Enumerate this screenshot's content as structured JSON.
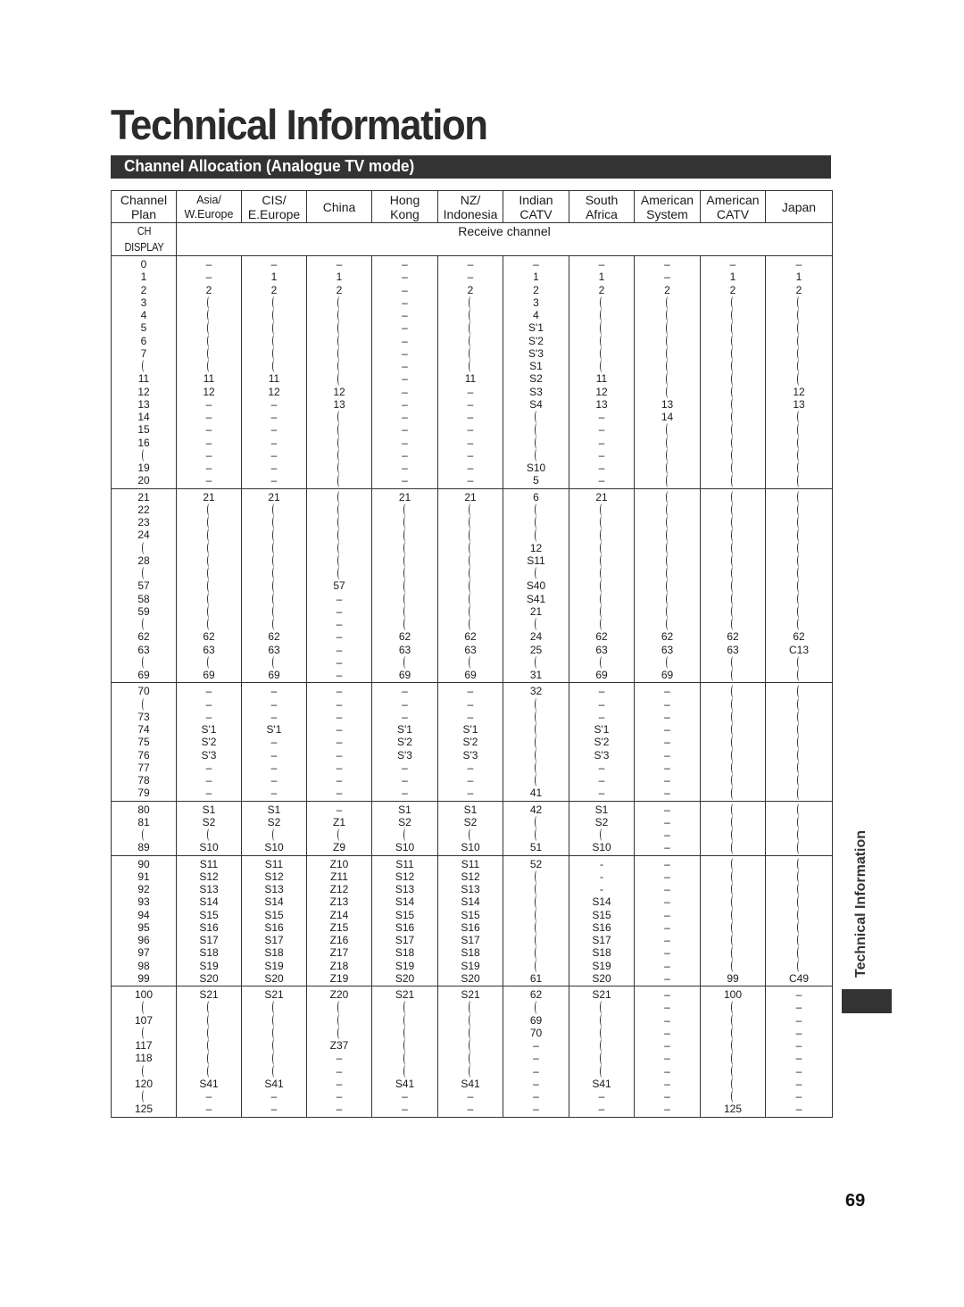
{
  "page": {
    "title": "Technical Information",
    "section_title": "Channel Allocation (Analogue TV mode)",
    "side_tab_label": "Technical Information",
    "page_number": "69"
  },
  "table": {
    "headers": [
      {
        "line1": "Channel",
        "line2": "Plan"
      },
      {
        "line1": "Asia/",
        "line2": "W.Europe"
      },
      {
        "line1": "CIS/",
        "line2": "E.Europe"
      },
      {
        "line1": "China",
        "line2": ""
      },
      {
        "line1": "Hong",
        "line2": "Kong"
      },
      {
        "line1": "NZ/",
        "line2": "Indonesia"
      },
      {
        "line1": "Indian",
        "line2": "CATV"
      },
      {
        "line1": "South",
        "line2": "Africa"
      },
      {
        "line1": "American",
        "line2": "System"
      },
      {
        "line1": "American",
        "line2": "CATV"
      },
      {
        "line1": "Japan",
        "line2": ""
      }
    ],
    "ch_display_label": "CH DISPLAY",
    "receive_channel_label": "Receive channel",
    "wave_marker": "~",
    "groups": [
      [
        [
          "0",
          "–",
          "–",
          "–",
          "–",
          "–",
          "–",
          "–",
          "–",
          "–",
          "–"
        ],
        [
          "1",
          "–",
          "1",
          "1",
          "–",
          "–",
          "1",
          "1",
          "–",
          "1",
          "1"
        ],
        [
          "2",
          "2",
          "2",
          "2",
          "–",
          "2",
          "2",
          "2",
          "2",
          "2",
          "2"
        ],
        [
          "3",
          "~",
          "~",
          "~",
          "–",
          "~",
          "3",
          "~",
          "~",
          "~",
          "~"
        ],
        [
          "4",
          "~",
          "~",
          "~",
          "–",
          "~",
          "4",
          "~",
          "~",
          "~",
          "~"
        ],
        [
          "5",
          "~",
          "~",
          "~",
          "–",
          "~",
          "S'1",
          "~",
          "~",
          "~",
          "~"
        ],
        [
          "6",
          "~",
          "~",
          "~",
          "–",
          "~",
          "S'2",
          "~",
          "~",
          "~",
          "~"
        ],
        [
          "7",
          "~",
          "~",
          "~",
          "–",
          "~",
          "S'3",
          "~",
          "~",
          "~",
          "~"
        ],
        [
          "~",
          "~",
          "~",
          "~",
          "–",
          "~",
          "S1",
          "~",
          "~",
          "~",
          "~"
        ],
        [
          "11",
          "11",
          "11",
          "~",
          "–",
          "11",
          "S2",
          "11",
          "~",
          "~",
          "~"
        ],
        [
          "12",
          "12",
          "12",
          "12",
          "–",
          "–",
          "S3",
          "12",
          "~",
          "~",
          "12"
        ],
        [
          "13",
          "–",
          "–",
          "13",
          "–",
          "–",
          "S4",
          "13",
          "13",
          "~",
          "13"
        ],
        [
          "14",
          "–",
          "–",
          "~",
          "–",
          "–",
          "~",
          "–",
          "14",
          "~",
          "~"
        ],
        [
          "15",
          "–",
          "–",
          "~",
          "–",
          "–",
          "~",
          "–",
          "~",
          "~",
          "~"
        ],
        [
          "16",
          "–",
          "–",
          "~",
          "–",
          "–",
          "~",
          "–",
          "~",
          "~",
          "~"
        ],
        [
          "~",
          "–",
          "–",
          "~",
          "–",
          "–",
          "~",
          "–",
          "~",
          "~",
          "~"
        ],
        [
          "19",
          "–",
          "–",
          "~",
          "–",
          "–",
          "S10",
          "–",
          "~",
          "~",
          "~"
        ],
        [
          "20",
          "–",
          "–",
          "~",
          "–",
          "–",
          "5",
          "–",
          "~",
          "~",
          "~"
        ]
      ],
      [
        [
          "21",
          "21",
          "21",
          "~",
          "21",
          "21",
          "6",
          "21",
          "~",
          "~",
          "~"
        ],
        [
          "22",
          "~",
          "~",
          "~",
          "~",
          "~",
          "~",
          "~",
          "~",
          "~",
          "~"
        ],
        [
          "23",
          "~",
          "~",
          "~",
          "~",
          "~",
          "~",
          "~",
          "~",
          "~",
          "~"
        ],
        [
          "24",
          "~",
          "~",
          "~",
          "~",
          "~",
          "~",
          "~",
          "~",
          "~",
          "~"
        ],
        [
          "~",
          "~",
          "~",
          "~",
          "~",
          "~",
          "12",
          "~",
          "~",
          "~",
          "~"
        ],
        [
          "28",
          "~",
          "~",
          "~",
          "~",
          "~",
          "S11",
          "~",
          "~",
          "~",
          "~"
        ],
        [
          "~",
          "~",
          "~",
          "~",
          "~",
          "~",
          "~",
          "~",
          "~",
          "~",
          "~"
        ],
        [
          "57",
          "~",
          "~",
          "57",
          "~",
          "~",
          "S40",
          "~",
          "~",
          "~",
          "~"
        ],
        [
          "58",
          "~",
          "~",
          "–",
          "~",
          "~",
          "S41",
          "~",
          "~",
          "~",
          "~"
        ],
        [
          "59",
          "~",
          "~",
          "–",
          "~",
          "~",
          "21",
          "~",
          "~",
          "~",
          "~"
        ],
        [
          "~",
          "~",
          "~",
          "–",
          "~",
          "~",
          "~",
          "~",
          "~",
          "~",
          "~"
        ],
        [
          "62",
          "62",
          "62",
          "–",
          "62",
          "62",
          "24",
          "62",
          "62",
          "62",
          "62"
        ],
        [
          "63",
          "63",
          "63",
          "–",
          "63",
          "63",
          "25",
          "63",
          "63",
          "63",
          "C13"
        ],
        [
          "~",
          "~",
          "~",
          "–",
          "~",
          "~",
          "~",
          "~",
          "~",
          "~",
          "~"
        ],
        [
          "69",
          "69",
          "69",
          "–",
          "69",
          "69",
          "31",
          "69",
          "69",
          "~",
          "~"
        ]
      ],
      [
        [
          "70",
          "–",
          "–",
          "–",
          "–",
          "–",
          "32",
          "–",
          "–",
          "~",
          "~"
        ],
        [
          "~",
          "–",
          "–",
          "–",
          "–",
          "–",
          "~",
          "–",
          "–",
          "~",
          "~"
        ],
        [
          "73",
          "–",
          "–",
          "–",
          "–",
          "–",
          "~",
          "–",
          "–",
          "~",
          "~"
        ],
        [
          "74",
          "S'1",
          "S'1",
          "–",
          "S'1",
          "S'1",
          "~",
          "S'1",
          "–",
          "~",
          "~"
        ],
        [
          "75",
          "S'2",
          "–",
          "–",
          "S'2",
          "S'2",
          "~",
          "S'2",
          "–",
          "~",
          "~"
        ],
        [
          "76",
          "S'3",
          "–",
          "–",
          "S'3",
          "S'3",
          "~",
          "S'3",
          "–",
          "~",
          "~"
        ],
        [
          "77",
          "–",
          "–",
          "–",
          "–",
          "–",
          "~",
          "–",
          "–",
          "~",
          "~"
        ],
        [
          "78",
          "–",
          "–",
          "–",
          "–",
          "–",
          "~",
          "–",
          "–",
          "~",
          "~"
        ],
        [
          "79",
          "–",
          "–",
          "–",
          "–",
          "–",
          "41",
          "–",
          "–",
          "~",
          "~"
        ]
      ],
      [
        [
          "80",
          "S1",
          "S1",
          "–",
          "S1",
          "S1",
          "42",
          "S1",
          "–",
          "~",
          "~"
        ],
        [
          "81",
          "S2",
          "S2",
          "Z1",
          "S2",
          "S2",
          "~",
          "S2",
          "–",
          "~",
          "~"
        ],
        [
          "~",
          "~",
          "~",
          "~",
          "~",
          "~",
          "~",
          "~",
          "–",
          "~",
          "~"
        ],
        [
          "89",
          "S10",
          "S10",
          "Z9",
          "S10",
          "S10",
          "51",
          "S10",
          "–",
          "~",
          "~"
        ]
      ],
      [
        [
          "90",
          "S11",
          "S11",
          "Z10",
          "S11",
          "S11",
          "52",
          "-",
          "–",
          "~",
          "~"
        ],
        [
          "91",
          "S12",
          "S12",
          "Z11",
          "S12",
          "S12",
          "~",
          "-",
          "–",
          "~",
          "~"
        ],
        [
          "92",
          "S13",
          "S13",
          "Z12",
          "S13",
          "S13",
          "~",
          "-",
          "–",
          "~",
          "~"
        ],
        [
          "93",
          "S14",
          "S14",
          "Z13",
          "S14",
          "S14",
          "~",
          "S14",
          "–",
          "~",
          "~"
        ],
        [
          "94",
          "S15",
          "S15",
          "Z14",
          "S15",
          "S15",
          "~",
          "S15",
          "–",
          "~",
          "~"
        ],
        [
          "95",
          "S16",
          "S16",
          "Z15",
          "S16",
          "S16",
          "~",
          "S16",
          "–",
          "~",
          "~"
        ],
        [
          "96",
          "S17",
          "S17",
          "Z16",
          "S17",
          "S17",
          "~",
          "S17",
          "–",
          "~",
          "~"
        ],
        [
          "97",
          "S18",
          "S18",
          "Z17",
          "S18",
          "S18",
          "~",
          "S18",
          "–",
          "~",
          "~"
        ],
        [
          "98",
          "S19",
          "S19",
          "Z18",
          "S19",
          "S19",
          "~",
          "S19",
          "–",
          "~",
          "~"
        ],
        [
          "99",
          "S20",
          "S20",
          "Z19",
          "S20",
          "S20",
          "61",
          "S20",
          "–",
          "99",
          "C49"
        ]
      ],
      [
        [
          "100",
          "S21",
          "S21",
          "Z20",
          "S21",
          "S21",
          "62",
          "S21",
          "–",
          "100",
          "–"
        ],
        [
          "~",
          "~",
          "~",
          "~",
          "~",
          "~",
          "~",
          "~",
          "–",
          "~",
          "–"
        ],
        [
          "107",
          "~",
          "~",
          "~",
          "~",
          "~",
          "69",
          "~",
          "–",
          "~",
          "–"
        ],
        [
          "~",
          "~",
          "~",
          "~",
          "~",
          "~",
          "70",
          "~",
          "–",
          "~",
          "–"
        ],
        [
          "117",
          "~",
          "~",
          "Z37",
          "~",
          "~",
          "–",
          "~",
          "–",
          "~",
          "–"
        ],
        [
          "118",
          "~",
          "~",
          "–",
          "~",
          "~",
          "–",
          "~",
          "–",
          "~",
          "–"
        ],
        [
          "~",
          "~",
          "~",
          "–",
          "~",
          "~",
          "–",
          "~",
          "–",
          "~",
          "–"
        ],
        [
          "120",
          "S41",
          "S41",
          "–",
          "S41",
          "S41",
          "–",
          "S41",
          "–",
          "~",
          "–"
        ],
        [
          "~",
          "–",
          "–",
          "–",
          "–",
          "–",
          "–",
          "–",
          "–",
          "~",
          "–"
        ],
        [
          "125",
          "–",
          "–",
          "–",
          "–",
          "–",
          "–",
          "–",
          "–",
          "125",
          "–"
        ]
      ]
    ]
  }
}
